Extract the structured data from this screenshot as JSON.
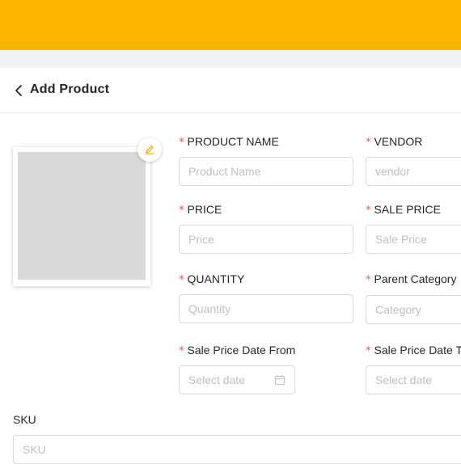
{
  "header": {
    "title": "Add Product"
  },
  "form": {
    "product_name": {
      "label": "PRODUCT NAME",
      "required_mark": "*",
      "placeholder": "Product Name",
      "value": ""
    },
    "vendor": {
      "label": "VENDOR",
      "required_mark": "*",
      "placeholder": "vendor",
      "value": ""
    },
    "price": {
      "label": "PRICE",
      "required_mark": "*",
      "placeholder": "Price",
      "value": ""
    },
    "sale_price": {
      "label": "SALE PRICE",
      "required_mark": "*",
      "placeholder": "Sale Price",
      "value": ""
    },
    "quantity": {
      "label": "QUANTITY",
      "required_mark": "*",
      "placeholder": "Quantity",
      "value": ""
    },
    "parent_category": {
      "label": "Parent Category",
      "required_mark": "*",
      "placeholder": "Category",
      "value": ""
    },
    "sale_price_date_from": {
      "label": "Sale Price Date From",
      "required_mark": "*",
      "placeholder": "Select date",
      "value": ""
    },
    "sale_price_date_to": {
      "label": "Sale Price Date To",
      "required_mark": "*",
      "placeholder": "Select date",
      "value": ""
    },
    "sku": {
      "label": "SKU",
      "placeholder": "SKU",
      "value": ""
    }
  },
  "colors": {
    "brand": "#fdb500",
    "required": "#ff4d4f",
    "edit_icon": "#f2a900"
  },
  "icons": {
    "back": "chevron-left-icon",
    "edit": "pencil-icon",
    "calendar": "calendar-icon"
  }
}
